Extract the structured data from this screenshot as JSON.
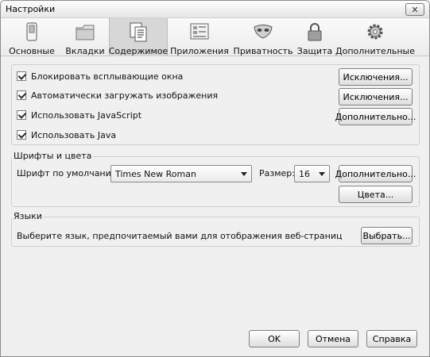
{
  "window": {
    "title": "Настройки",
    "close_glyph": "✕"
  },
  "toolbar": {
    "selected": "content",
    "panes": [
      {
        "id": "main",
        "label": "Основные",
        "icon": "switch-icon"
      },
      {
        "id": "tabs",
        "label": "Вкладки",
        "icon": "folder-tabs-icon"
      },
      {
        "id": "content",
        "label": "Содержимое",
        "icon": "document-content-icon"
      },
      {
        "id": "applications",
        "label": "Приложения",
        "icon": "applications-icon"
      },
      {
        "id": "privacy",
        "label": "Приватность",
        "icon": "mask-icon"
      },
      {
        "id": "security",
        "label": "Защита",
        "icon": "padlock-icon"
      },
      {
        "id": "advanced",
        "label": "Дополнительные",
        "icon": "gear-icon"
      }
    ]
  },
  "content": {
    "block_popups": {
      "label": "Блокировать всплывающие окна",
      "checked": true,
      "exceptions_label": "Исключения..."
    },
    "load_images": {
      "label": "Автоматически загружать изображения",
      "checked": true,
      "exceptions_label": "Исключения..."
    },
    "javascript": {
      "label": "Использовать JavaScript",
      "checked": true,
      "advanced_label": "Дополнительно..."
    },
    "java": {
      "label": "Использовать Java",
      "checked": true
    }
  },
  "fonts": {
    "group_title": "Шрифты и цвета",
    "default_font_label": "Шрифт по умолчанию:",
    "default_font_value": "Times New Roman",
    "size_label": "Размер:",
    "size_value": "16",
    "advanced_label": "Дополнительно...",
    "colors_label": "Цвета..."
  },
  "languages": {
    "group_title": "Языки",
    "description": "Выберите язык, предпочитаемый вами для отображения веб-страниц",
    "choose_label": "Выбрать..."
  },
  "footer": {
    "ok_label": "OK",
    "cancel_label": "Отмена",
    "help_label": "Справка"
  }
}
